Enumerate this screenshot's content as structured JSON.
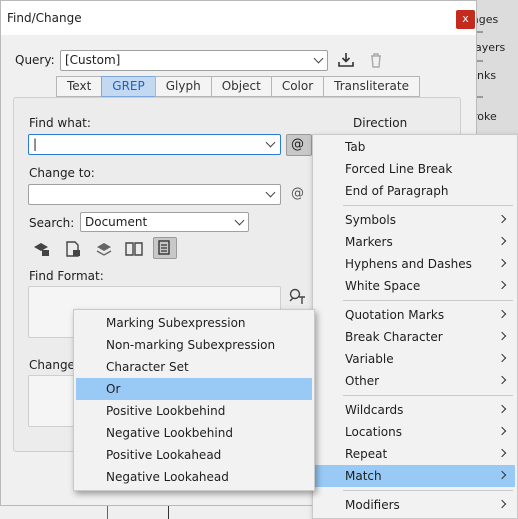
{
  "background_panel": {
    "items": [
      "ages",
      "ayers",
      "nks",
      "roke"
    ]
  },
  "dialog": {
    "title": "Find/Change",
    "close_label": "x",
    "query": {
      "label": "Query:",
      "value": "[Custom]"
    },
    "tabs": [
      "Text",
      "GREP",
      "Glyph",
      "Object",
      "Color",
      "Transliterate"
    ],
    "active_tab": "GREP",
    "find_what": {
      "label": "Find what:",
      "value": "|"
    },
    "change_to": {
      "label": "Change to:",
      "value": ""
    },
    "search": {
      "label": "Search:",
      "value": "Document"
    },
    "find_format": {
      "label": "Find Format:"
    },
    "change_format": {
      "label": "Change"
    },
    "direction": {
      "label": "Direction"
    },
    "special_char_icon": "@"
  },
  "special_menu": {
    "items": [
      {
        "label": "Tab",
        "submenu": false
      },
      {
        "label": "Forced Line Break",
        "submenu": false
      },
      {
        "label": "End of Paragraph",
        "submenu": false
      },
      {
        "label": "Symbols",
        "submenu": true
      },
      {
        "label": "Markers",
        "submenu": true
      },
      {
        "label": "Hyphens and Dashes",
        "submenu": true
      },
      {
        "label": "White Space",
        "submenu": true
      },
      {
        "label": "Quotation Marks",
        "submenu": true
      },
      {
        "label": "Break Character",
        "submenu": true
      },
      {
        "label": "Variable",
        "submenu": true
      },
      {
        "label": "Other",
        "submenu": true
      },
      {
        "label": "Wildcards",
        "submenu": true
      },
      {
        "label": "Locations",
        "submenu": true
      },
      {
        "label": "Repeat",
        "submenu": true
      },
      {
        "label": "Match",
        "submenu": true,
        "highlighted": true
      },
      {
        "label": "Modifiers",
        "submenu": true
      }
    ]
  },
  "match_submenu": {
    "items": [
      {
        "label": "Marking Subexpression"
      },
      {
        "label": "Non-marking Subexpression"
      },
      {
        "label": "Character Set"
      },
      {
        "label": "Or",
        "highlighted": true
      },
      {
        "label": "Positive Lookbehind"
      },
      {
        "label": "Negative Lookbehind"
      },
      {
        "label": "Positive Lookahead"
      },
      {
        "label": "Negative Lookahead"
      }
    ]
  },
  "colors": {
    "highlight": "#99c9f5",
    "active_tab_text": "#2060c0",
    "close_button": "#c42b1c"
  }
}
